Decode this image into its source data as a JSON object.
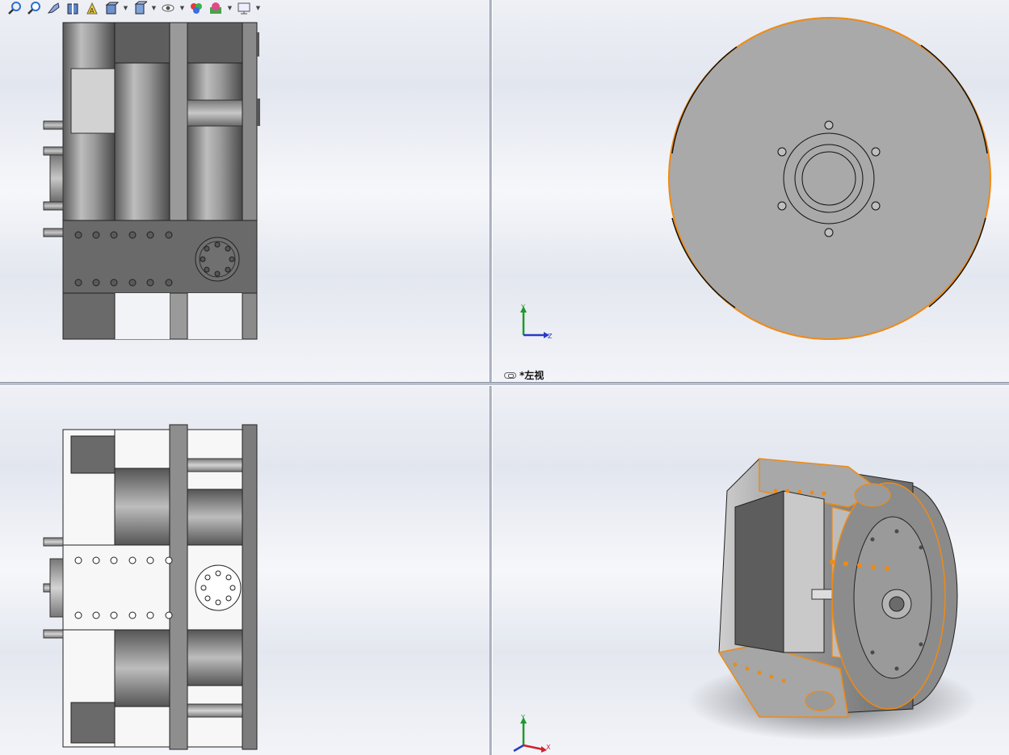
{
  "toolbar": {
    "icons": [
      "zoom-to-fit-icon",
      "zoom-area-icon",
      "previous-view-icon",
      "section-view-icon",
      "dynamic-annotation-icon",
      "view-orientation-icon",
      "display-style-icon",
      "hide-show-items-icon",
      "edit-appearance-icon",
      "apply-scene-icon",
      "view-settings-icon"
    ]
  },
  "viewports": {
    "top_right": {
      "label": "*左视"
    }
  },
  "triad": {
    "y": "Y",
    "z": "Z",
    "x": "X"
  },
  "colors": {
    "selection": "#f08a12",
    "part": "#9a9a9a",
    "triad_x": "#d0202a",
    "triad_y": "#1d9a2a",
    "triad_z": "#2a3ac8"
  }
}
